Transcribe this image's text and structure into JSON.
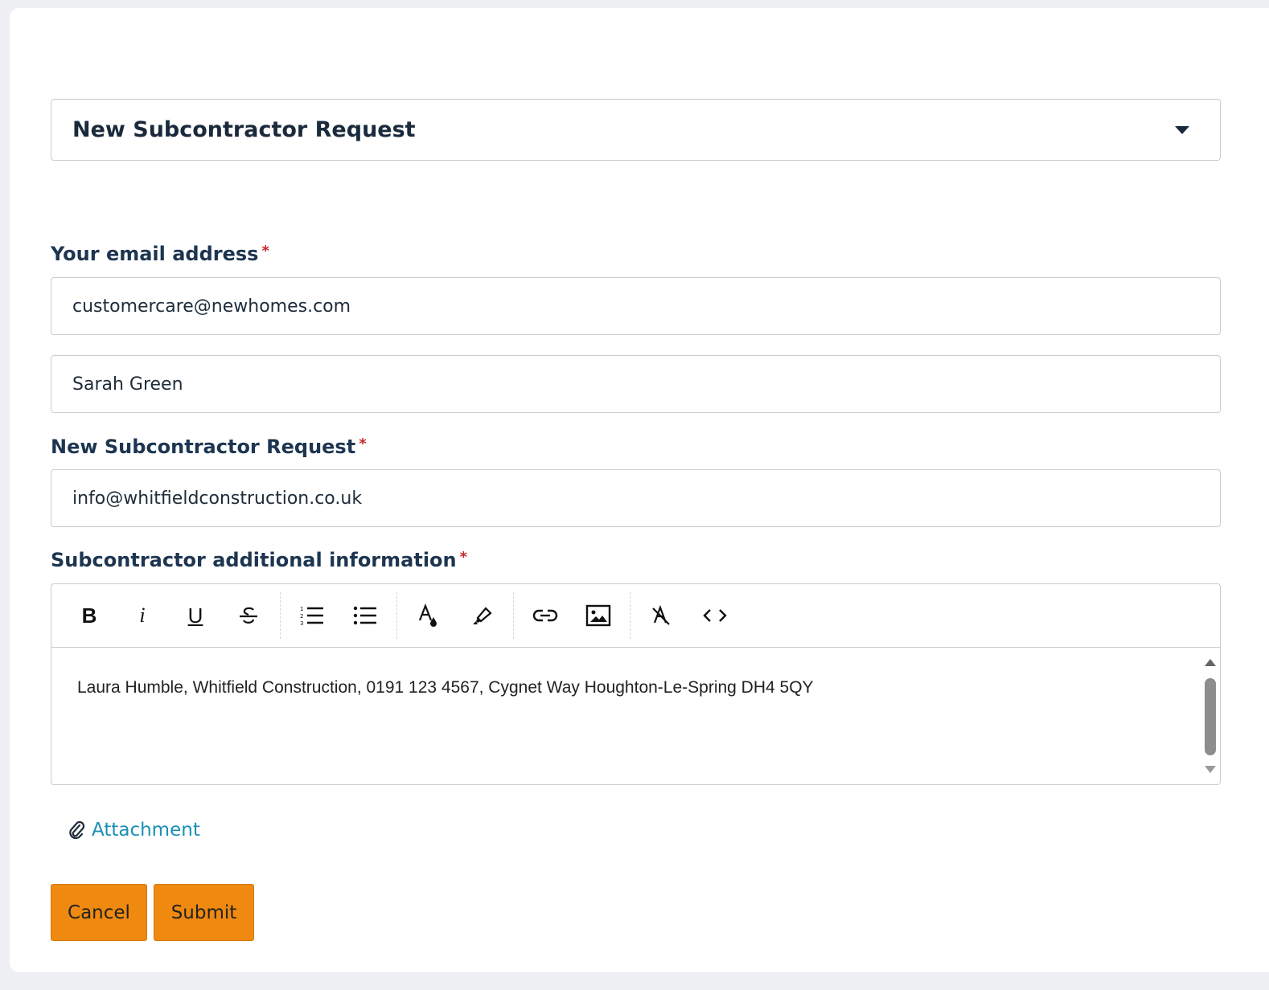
{
  "request_type": {
    "selected": "New Subcontractor Request"
  },
  "email": {
    "label": "Your email address",
    "required_marker": "*",
    "value": "customercare@newhomes.com"
  },
  "name": {
    "value": "Sarah Green"
  },
  "subcontractor": {
    "label": "New Subcontractor Request",
    "required_marker": "*",
    "value": "info@whitfieldconstruction.co.uk"
  },
  "additional_info": {
    "label": "Subcontractor additional information",
    "required_marker": "*",
    "toolbar": {
      "bold": "B",
      "italic": "i",
      "underline": "U",
      "icons": [
        "bold-icon",
        "italic-icon",
        "underline-icon",
        "strikethrough-icon",
        "ordered-list-icon",
        "bullet-list-icon",
        "font-color-icon",
        "highlight-icon",
        "link-icon",
        "image-icon",
        "clear-format-icon",
        "code-view-icon"
      ]
    },
    "content": "Laura Humble, Whitfield Construction, 0191 123 4567, Cygnet Way Houghton-Le-Spring DH4 5QY"
  },
  "attachment": {
    "label": "Attachment"
  },
  "actions": {
    "cancel": "Cancel",
    "submit": "Submit"
  },
  "colors": {
    "accent_button": "#f0890f",
    "link": "#1a8fb5",
    "required": "#c62828",
    "label": "#1d3550"
  }
}
